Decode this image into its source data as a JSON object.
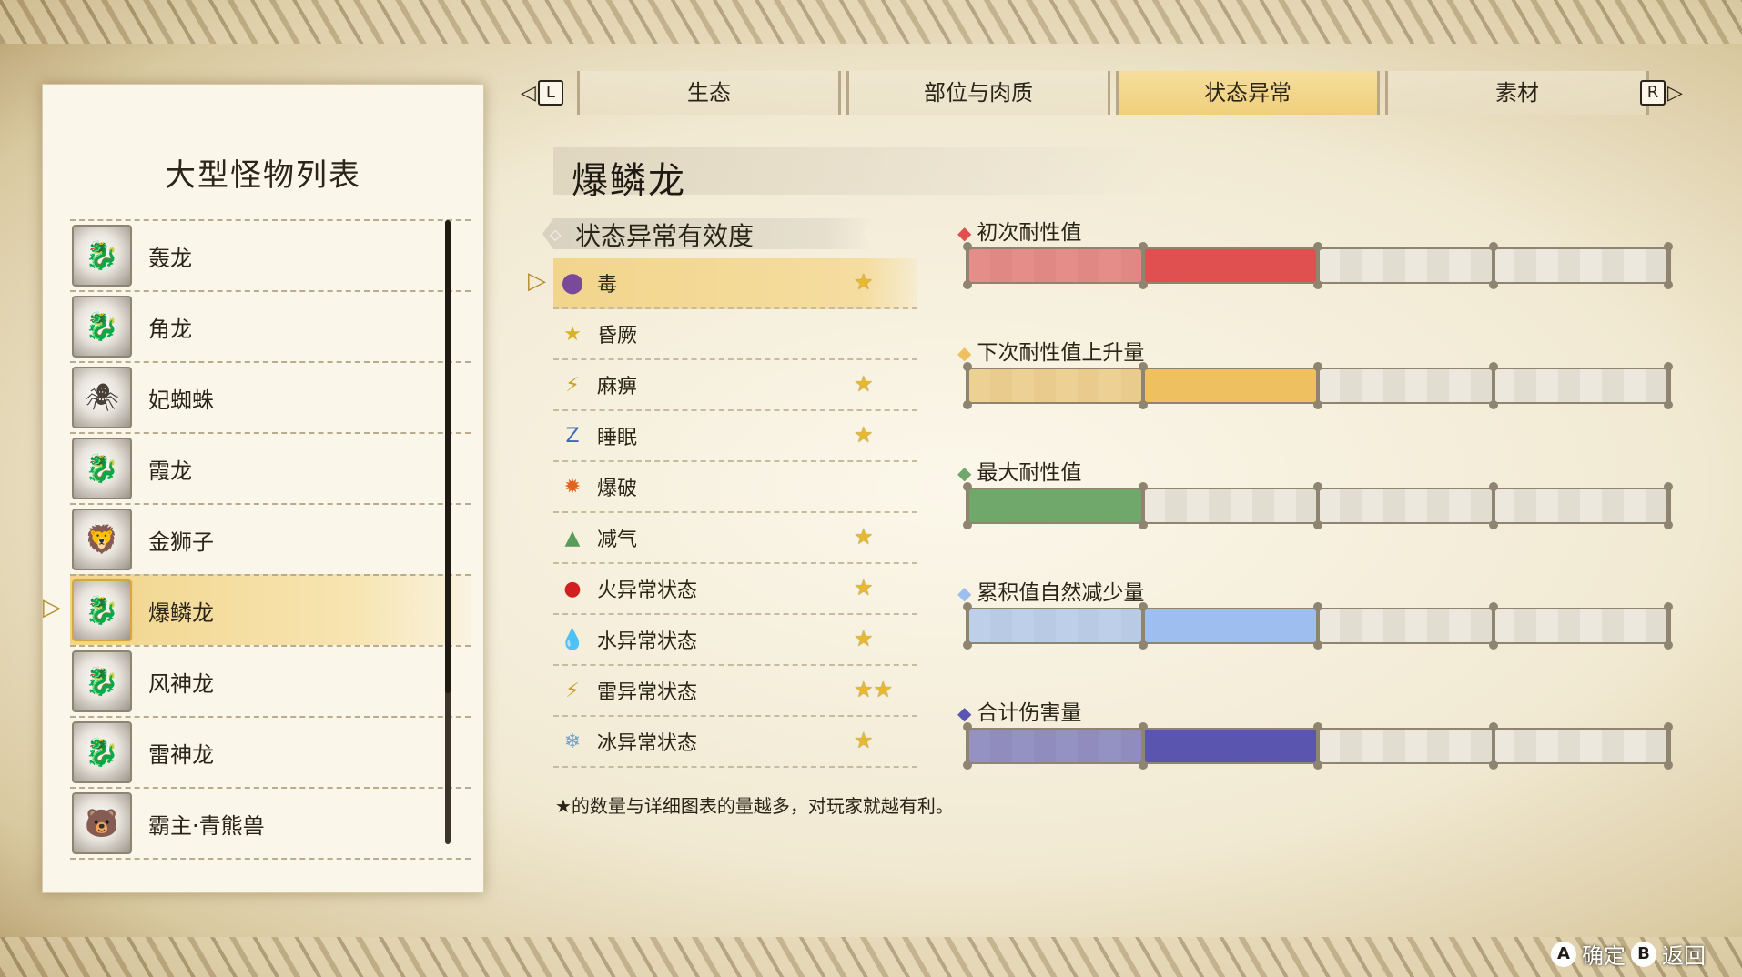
{
  "left_panel": {
    "title": "大型怪物列表",
    "monsters": [
      {
        "name": "轰龙",
        "icon": "dragon-icon"
      },
      {
        "name": "角龙",
        "icon": "dragon-icon"
      },
      {
        "name": "妃蜘蛛",
        "icon": "spider-icon"
      },
      {
        "name": "霞龙",
        "icon": "dragon-icon"
      },
      {
        "name": "金狮子",
        "icon": "beast-icon"
      },
      {
        "name": "爆鳞龙",
        "icon": "dragon-icon",
        "selected": true
      },
      {
        "name": "风神龙",
        "icon": "dragon-icon"
      },
      {
        "name": "雷神龙",
        "icon": "dragon-icon"
      },
      {
        "name": "霸主·青熊兽",
        "icon": "bear-icon"
      }
    ]
  },
  "tabs": {
    "left_key": "L",
    "right_key": "R",
    "items": [
      "生态",
      "部位与肉质",
      "状态异常",
      "素材"
    ],
    "active_index": 2
  },
  "monster_title": "爆鳞龙",
  "status": {
    "header": "状态异常有效度",
    "rows": [
      {
        "name": "毒",
        "stars": 1,
        "selected": true,
        "icon": "poison-icon"
      },
      {
        "name": "昏厥",
        "stars": 0,
        "icon": "stun-icon"
      },
      {
        "name": "麻痹",
        "stars": 1,
        "icon": "paralysis-icon"
      },
      {
        "name": "睡眠",
        "stars": 1,
        "icon": "sleep-icon"
      },
      {
        "name": "爆破",
        "stars": 0,
        "icon": "blast-icon"
      },
      {
        "name": "减气",
        "stars": 1,
        "icon": "exhaust-icon"
      },
      {
        "name": "火异常状态",
        "stars": 1,
        "icon": "fire-icon"
      },
      {
        "name": "水异常状态",
        "stars": 1,
        "icon": "water-icon"
      },
      {
        "name": "雷异常状态",
        "stars": 2,
        "icon": "thunder-icon"
      },
      {
        "name": "冰异常状态",
        "stars": 1,
        "icon": "ice-icon"
      }
    ],
    "footnote": "★的数量与详细图表的量越多，对玩家就越有利。"
  },
  "chart_data": {
    "type": "bar",
    "segments_max": 4,
    "series": [
      {
        "name": "初次耐性值",
        "value": 2,
        "color": "#e05050"
      },
      {
        "name": "下次耐性值上升量",
        "value": 2,
        "color": "#eec060"
      },
      {
        "name": "最大耐性值",
        "value": 1,
        "color": "#6fa86a"
      },
      {
        "name": "累积值自然减少量",
        "value": 2,
        "color": "#9fbef0"
      },
      {
        "name": "合计伤害量",
        "value": 2,
        "color": "#5a56b0"
      }
    ]
  },
  "bottom_hint": {
    "confirm_button": "A",
    "confirm_label": "确定",
    "back_button": "B",
    "back_label": "返回"
  }
}
